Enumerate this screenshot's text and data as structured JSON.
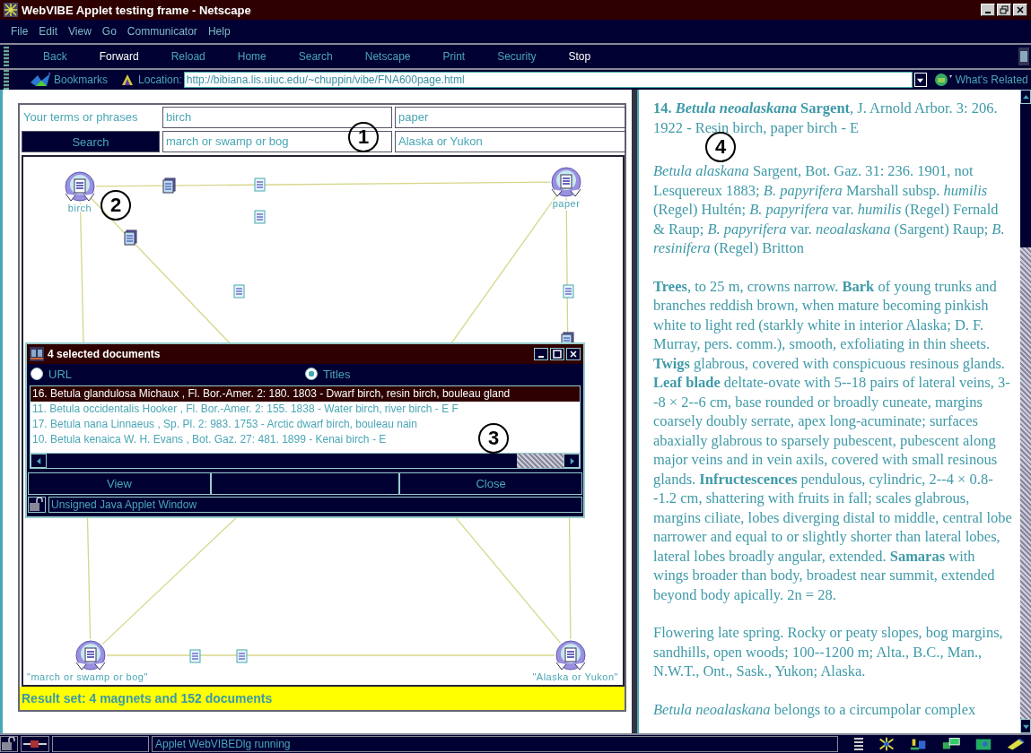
{
  "window": {
    "title": "WebVIBE Applet testing frame - Netscape"
  },
  "menu": [
    "File",
    "Edit",
    "View",
    "Go",
    "Communicator",
    "Help"
  ],
  "toolbar": [
    {
      "label": "Back",
      "highlighted": false
    },
    {
      "label": "Forward",
      "highlighted": true
    },
    {
      "label": "Reload",
      "highlighted": false
    },
    {
      "label": "Home",
      "highlighted": false
    },
    {
      "label": "Search",
      "highlighted": false
    },
    {
      "label": "Netscape",
      "highlighted": false
    },
    {
      "label": "Print",
      "highlighted": false
    },
    {
      "label": "Security",
      "highlighted": false
    },
    {
      "label": "Stop",
      "highlighted": true
    }
  ],
  "location_bar": {
    "bookmarks": "Bookmarks",
    "label": "Location:",
    "url": "http://bibiana.lis.uiuc.edu/~chuppin/vibe/FNA600page.html",
    "related": "What's Related"
  },
  "applet": {
    "terms_label": "Your terms or phrases",
    "search_button": "Search",
    "fields": [
      "birch",
      "paper",
      "march or swamp or bog",
      "Alaska or Yukon"
    ],
    "magnets": [
      {
        "label": "birch"
      },
      {
        "label": "paper"
      },
      {
        "label": "\"march or swamp or bog\""
      },
      {
        "label": "\"Alaska or Yukon\""
      }
    ],
    "result": "Result set: 4 magnets and 152 documents"
  },
  "dialog": {
    "title": "4 selected documents",
    "options": [
      {
        "label": "URL",
        "selected": false
      },
      {
        "label": "Titles",
        "selected": true
      }
    ],
    "rows": [
      {
        "text": "16. Betula glandulosa Michaux , Fl. Bor.-Amer. 2: 180. 1803 - Dwarf birch, resin birch, bouleau gland",
        "selected": true
      },
      {
        "text": "11. Betula occidentalis Hooker , Fl. Bor.-Amer. 2: 155. 1838 - Water birch, river birch - E F",
        "selected": false
      },
      {
        "text": "17. Betula nana Linnaeus , Sp. Pl. 2: 983. 1753 - Arctic dwarf birch, bouleau nain",
        "selected": false
      },
      {
        "text": "10. Betula kenaica W. H. Evans , Bot. Gaz. 27: 481. 1899 - Kenai birch - E",
        "selected": false
      }
    ],
    "buttons": [
      "View",
      "Close"
    ],
    "status": "Unsigned Java Applet Window"
  },
  "document": {
    "paragraphs": [
      "**14.** *Betula neoalaskana* **Sargent**, J. Arnold Arbor. 3: 206. 1922 - Resin birch, paper birch - E",
      "*Betula alaskana* Sargent, Bot. Gaz. 31: 236. 1901, not Lesquereux 1883; *B. papyrifera* Marshall subsp. *humilis* (Regel) Hultén; *B. papyrifera* var. *humilis* (Regel) Fernald & Raup; *B. papyrifera* var. *neoalaskana* (Sargent) Raup; *B. resinifera* (Regel) Britton",
      "**Trees**, to 25 m, crowns narrow. **Bark** of young trunks and branches reddish brown, when mature becoming pinkish white to light red (starkly white in interior Alaska; D. F. Murray, pers. comm.), smooth, exfoliating in thin sheets. **Twigs** glabrous, covered with conspicuous resinous glands. **Leaf blade** deltate-ovate with 5--18 pairs of lateral veins, 3--8 × 2--6 cm, base rounded or broadly cuneate, margins coarsely doubly serrate, apex long-acuminate; surfaces abaxially glabrous to sparsely pubescent, pubescent along major veins and in vein axils, covered with small resinous glands. **Infructescences** pendulous, cylindric, 2--4 × 0.8--1.2 cm, shattering with fruits in fall; scales glabrous, margins ciliate, lobes diverging distal to middle, central lobe narrower and equal to or slightly shorter than lateral lobes, lateral lobes broadly angular, extended. **Samaras** with wings broader than body, broadest near summit, extended beyond body apically. 2n = 28.",
      "Flowering late spring. Rocky or peaty slopes, bog margins, sandhills, open woods; 100--1200 m; Alta., B.C., Man., N.W.T., Ont., Sask., Yukon; Alaska.",
      "*Betula neoalaskana* belongs to a circumpolar complex"
    ]
  },
  "status_bar": {
    "text": "Applet WebVIBEDlg running"
  },
  "callouts": [
    "1",
    "2",
    "3",
    "4"
  ]
}
